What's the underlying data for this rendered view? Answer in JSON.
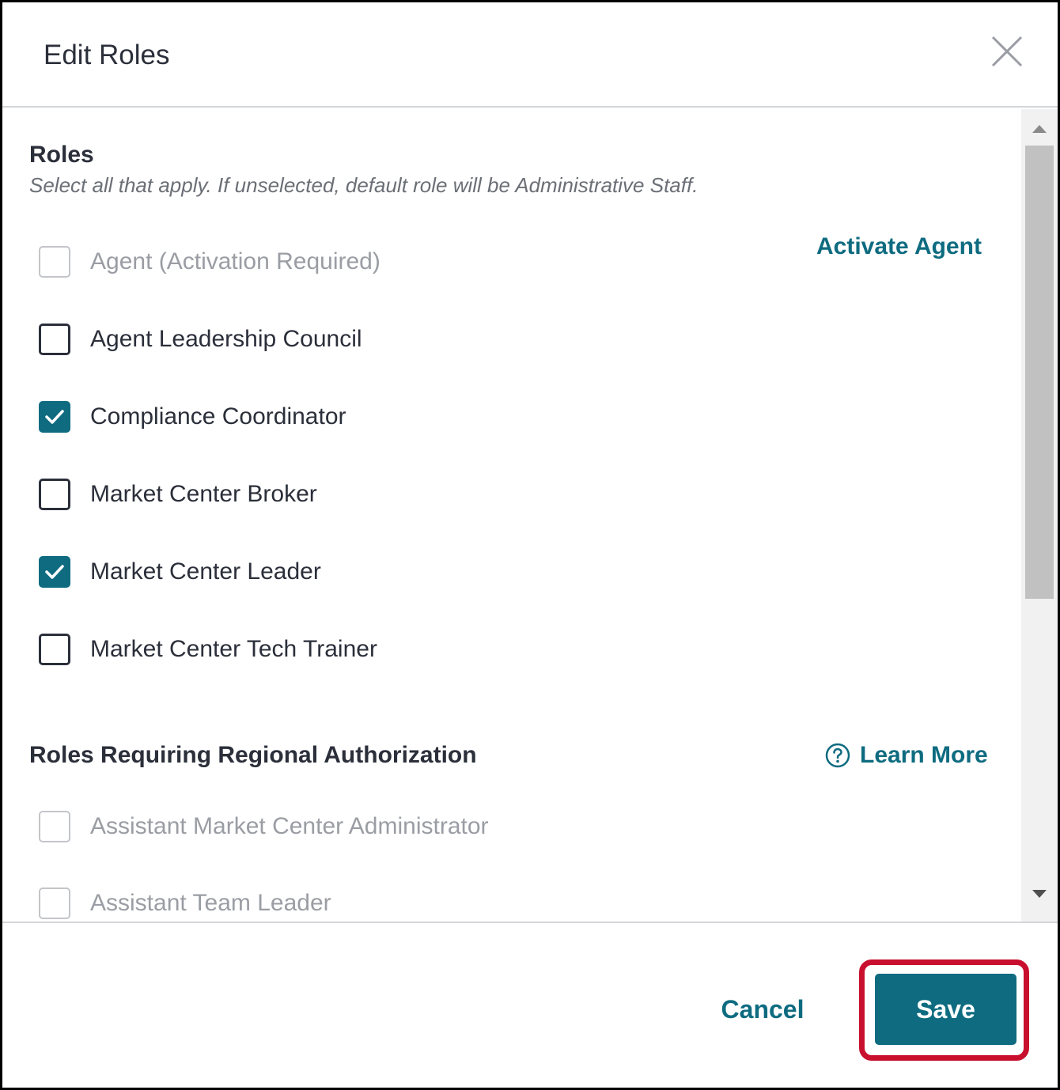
{
  "dialog": {
    "title": "Edit Roles"
  },
  "roles_section": {
    "title": "Roles",
    "subtitle": "Select all that apply. If unselected, default role will be Administrative Staff.",
    "action_link": "Activate Agent",
    "items": [
      {
        "label": "Agent (Activation Required)",
        "checked": false,
        "disabled": true
      },
      {
        "label": "Agent Leadership Council",
        "checked": false,
        "disabled": false
      },
      {
        "label": "Compliance Coordinator",
        "checked": true,
        "disabled": false
      },
      {
        "label": "Market Center Broker",
        "checked": false,
        "disabled": false
      },
      {
        "label": "Market Center Leader",
        "checked": true,
        "disabled": false
      },
      {
        "label": "Market Center Tech Trainer",
        "checked": false,
        "disabled": false
      }
    ]
  },
  "regional_section": {
    "title": "Roles Requiring Regional Authorization",
    "learn_more": "Learn More",
    "items": [
      {
        "label": "Assistant Market Center Administrator",
        "checked": false,
        "disabled": true
      },
      {
        "label": "Assistant Team Leader",
        "checked": false,
        "disabled": true
      }
    ]
  },
  "footer": {
    "cancel_label": "Cancel",
    "save_label": "Save"
  },
  "colors": {
    "accent": "#0e6b80",
    "highlight": "#c8102e",
    "text": "#2b2f3a",
    "muted": "#9a9da3"
  },
  "icons": {
    "close": "close-icon",
    "help": "help-circle-icon",
    "check": "checkmark-icon"
  }
}
